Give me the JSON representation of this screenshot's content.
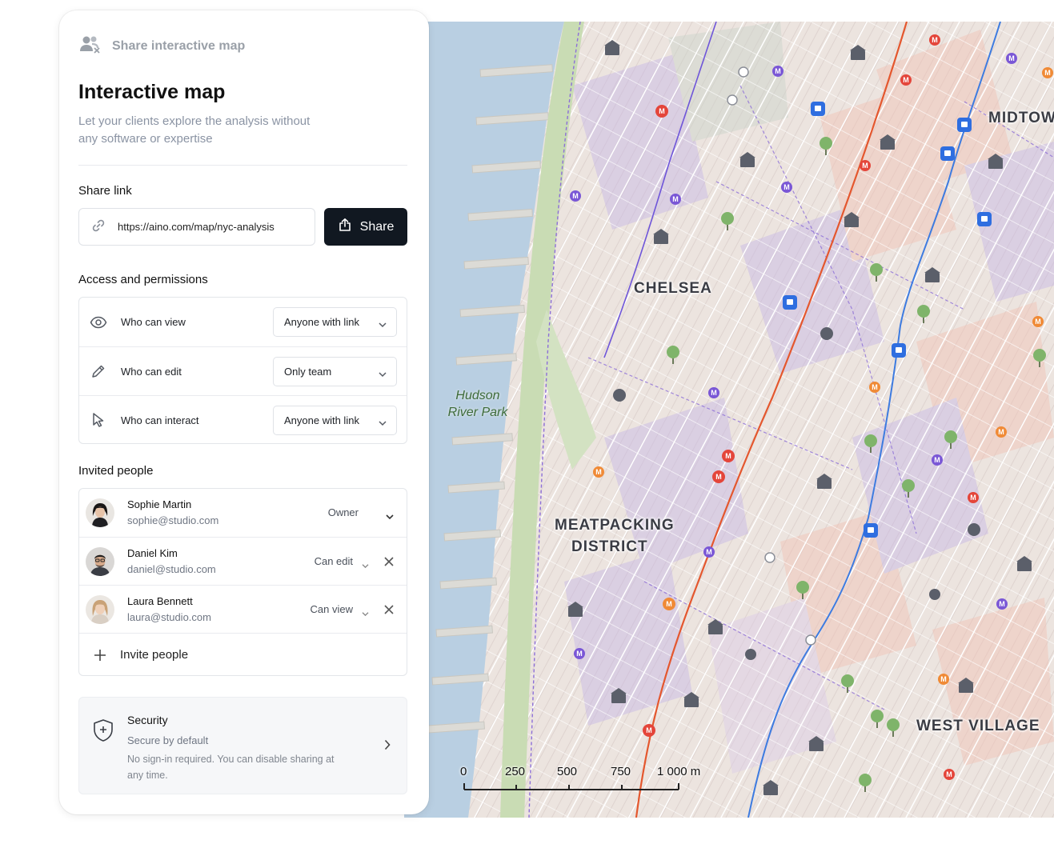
{
  "header": {
    "title": "Share interactive map"
  },
  "main": {
    "title": "Interactive map",
    "subtitle": "Let your clients explore the analysis without any software or expertise"
  },
  "share": {
    "section_label": "Share link",
    "url": "https://aino.com/map/nyc-analysis",
    "button_label": "Share"
  },
  "access": {
    "section_label": "Access and permissions",
    "rows": [
      {
        "label": "Who can view",
        "value": "Anyone with link",
        "icon": "eye-icon"
      },
      {
        "label": "Who can edit",
        "value": "Only team",
        "icon": "pencil-icon"
      },
      {
        "label": "Who can interact",
        "value": "Anyone with link",
        "icon": "cursor-icon"
      }
    ]
  },
  "people": {
    "section_label": "Invited people",
    "list": [
      {
        "name": "Sophie Martin",
        "email": "sophie@studio.com",
        "role": "Owner"
      },
      {
        "name": "Daniel Kim",
        "email": "daniel@studio.com",
        "role": "Can edit"
      },
      {
        "name": "Laura Bennett",
        "email": "laura@studio.com",
        "role": "Can view"
      }
    ],
    "invite_label": "Invite people"
  },
  "security": {
    "title": "Security",
    "subtitle": "Secure by default",
    "description": "No sign-in required. You can disable sharing at any time."
  },
  "map": {
    "neighborhoods": [
      "CHELSEA",
      "MEATPACKING",
      "DISTRICT",
      "WEST VILLAGE",
      "MIDTOW"
    ],
    "park": [
      "Hudson",
      "River Park"
    ],
    "scale": [
      "0",
      "250",
      "500",
      "750",
      "1 000 m"
    ],
    "colors": {
      "water": "#b9cfe2",
      "park": "#c9dcb4",
      "red_line": "#e4572e",
      "blue_line": "#3d7be0",
      "purple_line": "#6e55d9"
    }
  }
}
